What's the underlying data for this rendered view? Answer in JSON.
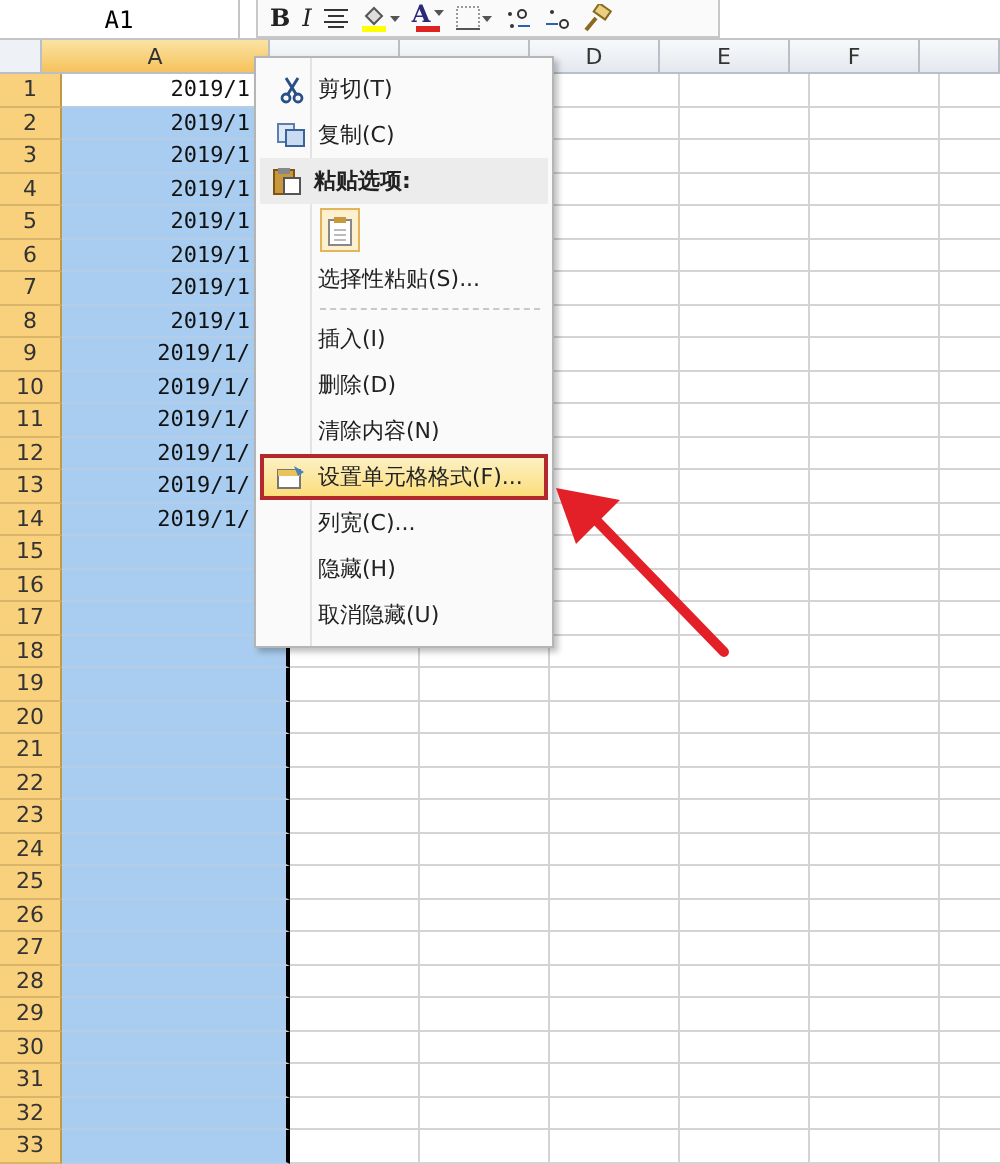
{
  "name_box": "A1",
  "mini_toolbar": [
    {
      "kind": "bold",
      "label": "B"
    },
    {
      "kind": "italic",
      "label": "I"
    },
    {
      "kind": "align"
    },
    {
      "kind": "fill",
      "dropdown": true
    },
    {
      "kind": "font_color",
      "label": "A",
      "dropdown": true
    },
    {
      "kind": "border",
      "dropdown": true
    },
    {
      "kind": "inc_decimal"
    },
    {
      "kind": "dec_decimal"
    },
    {
      "kind": "painter"
    }
  ],
  "columns": [
    {
      "label": "A",
      "selected": true
    },
    {
      "selected": false
    },
    {
      "selected": false
    },
    {
      "label": "D",
      "selected": false
    },
    {
      "label": "E",
      "selected": false
    },
    {
      "label": "F",
      "selected": false
    }
  ],
  "rows": [
    {
      "number": "1",
      "value": "2019/1",
      "active": true
    },
    {
      "number": "2",
      "value": "2019/1",
      "active": false
    },
    {
      "number": "3",
      "value": "2019/1",
      "active": false
    },
    {
      "number": "4",
      "value": "2019/1",
      "active": false
    },
    {
      "number": "5",
      "value": "2019/1",
      "active": false
    },
    {
      "number": "6",
      "value": "2019/1",
      "active": false
    },
    {
      "number": "7",
      "value": "2019/1",
      "active": false
    },
    {
      "number": "8",
      "value": "2019/1",
      "active": false
    },
    {
      "number": "9",
      "value": "2019/1/",
      "active": false
    },
    {
      "number": "10",
      "value": "2019/1/",
      "active": false
    },
    {
      "number": "11",
      "value": "2019/1/",
      "active": false
    },
    {
      "number": "12",
      "value": "2019/1/",
      "active": false
    },
    {
      "number": "13",
      "value": "2019/1/",
      "active": false
    },
    {
      "number": "14",
      "value": "2019/1/",
      "active": false
    },
    {
      "number": "15",
      "active": false
    },
    {
      "number": "16",
      "active": false
    },
    {
      "number": "17",
      "active": false
    },
    {
      "number": "18",
      "active": false
    },
    {
      "number": "19",
      "active": false
    },
    {
      "number": "20",
      "active": false
    },
    {
      "number": "21",
      "active": false
    },
    {
      "number": "22",
      "active": false
    },
    {
      "number": "23",
      "active": false
    },
    {
      "number": "24",
      "active": false
    },
    {
      "number": "25",
      "active": false
    },
    {
      "number": "26",
      "active": false
    },
    {
      "number": "27",
      "active": false
    },
    {
      "number": "28",
      "active": false
    },
    {
      "number": "29",
      "active": false
    },
    {
      "number": "30",
      "active": false
    },
    {
      "number": "31",
      "active": false
    },
    {
      "number": "32",
      "active": false
    },
    {
      "number": "33",
      "active": false
    }
  ],
  "context_menu": [
    {
      "kind": "cut",
      "label": "剪切(T)",
      "selected": false
    },
    {
      "kind": "copy",
      "label": "复制(C)",
      "selected": false
    },
    {
      "kind": "header",
      "label": "粘贴选项:"
    },
    {
      "kind": "paste_options"
    },
    {
      "kind": "item",
      "label": "选择性粘贴(S)...",
      "selected": false
    },
    {
      "kind": "separator"
    },
    {
      "kind": "item",
      "label": "插入(I)",
      "selected": false
    },
    {
      "kind": "item",
      "label": "删除(D)",
      "selected": false
    },
    {
      "kind": "item",
      "label": "清除内容(N)",
      "selected": false
    },
    {
      "kind": "format",
      "label": "设置单元格格式(F)...",
      "selected": true
    },
    {
      "kind": "item",
      "label": "列宽(C)...",
      "selected": false
    },
    {
      "kind": "item",
      "label": "隐藏(H)",
      "selected": false
    },
    {
      "kind": "item",
      "label": "取消隐藏(U)",
      "selected": false
    }
  ]
}
